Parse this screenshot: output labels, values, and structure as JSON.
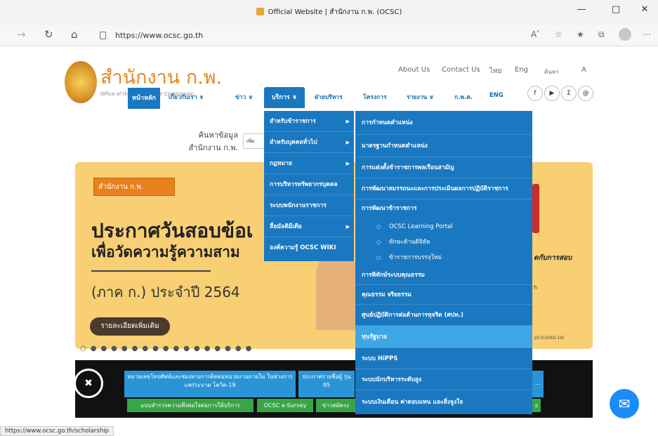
{
  "browser": {
    "title": "Official Website | สำนักงาน ก.พ. (OCSC)",
    "url": "https://www.ocsc.go.th",
    "status_url": "https://www.ocsc.go.th/scholarship",
    "read_aloud": "Aʹ"
  },
  "header": {
    "logo_th": "สำนักงาน ก.พ.",
    "logo_en": "Office of the Civil Service Commission",
    "links": [
      "About Us",
      "Contact Us",
      "ไทย",
      "Eng",
      "ค้นหา",
      "A"
    ],
    "social": [
      "f",
      "▶",
      "Σ",
      "@"
    ]
  },
  "menu": {
    "home": "หน้าหลัก",
    "items": [
      "เกี่ยวกับเรา ∨",
      "ข่าว ∨",
      "บริการ ∨",
      "ฝ่ายบริหาร",
      "โครงการ",
      "รายงาน ∨",
      "ก.พ.ค.",
      "ENG"
    ]
  },
  "search": {
    "label": "ค้นหาข้อมูล สำนักงาน ก.พ.",
    "placeholder": "เพิ่ม"
  },
  "banner": {
    "logo": "สำนักงาน ก.พ.",
    "line1": "ประกาศวันสอบข้อเ",
    "line2": "เพื่อวัดความรู้ความสาม",
    "line3": "(ภาค ก.) ประจำปี 2564",
    "more": "รายละเอียดเพิ่มเติม",
    "side1": "ดกับการสอบ",
    "side2": "h",
    "side3": "19 (COVID-19)"
  },
  "services_menu": [
    "สำหรับข้าราชการ",
    "สำหรับบุคคลทั่วไป",
    "กฎหมาย",
    "การบริหารทรัพยากรบุคคล",
    "ระบบพนักงานราชการ",
    "สื่อมัลติมีเดีย",
    "องค์ความรู้ OCSC WIKI"
  ],
  "submenu": {
    "items_top": [
      "การกำหนดตำแหน่ง",
      "มาตรฐานกำหนดตำแหน่ง",
      "การแต่งตั้งข้าราชการพลเรือนสามัญ",
      "การพัฒนาสมรรถนะและการประเมินผลการปฏิบัติราชการ",
      "การพัฒนาข้าราชการ"
    ],
    "subitems": [
      "OCSC Learning Portal",
      "ทักษะด้านดิจิทัล",
      "ข้าราชการบรรจุใหม่"
    ],
    "items_bottom": [
      "การพิทักษ์ระบบคุณธรรม",
      "คุณธรรม จริยธรรม",
      "ศูนย์ปฏิบัติการต่อต้านการทุจริต (ศปท.)",
      "ทุนรัฐบาล",
      "ระบบ HiPPS",
      "ระบบนักบริหารระดับสูง",
      "ระบบเงินเดือน ค่าตอบแทน และสิ่งจูงใจ"
    ]
  },
  "bottom_bar": {
    "blue1": "หมายเลขโทรศัพท์และช่องทางการติดต่อหน่วยงานภายใน ในช่วงการแพร่ระบาด โควิด-19",
    "blue2": "ประกาศรายชื่อผู้ รุ่น 95",
    "blue3": "...",
    "green1": "แบบสำรวจความพึงพอใจต่อการให้บริการ",
    "green2": "OCSC e-Survey",
    "green3": "ข่าวสมัครง",
    "green4": "s"
  }
}
